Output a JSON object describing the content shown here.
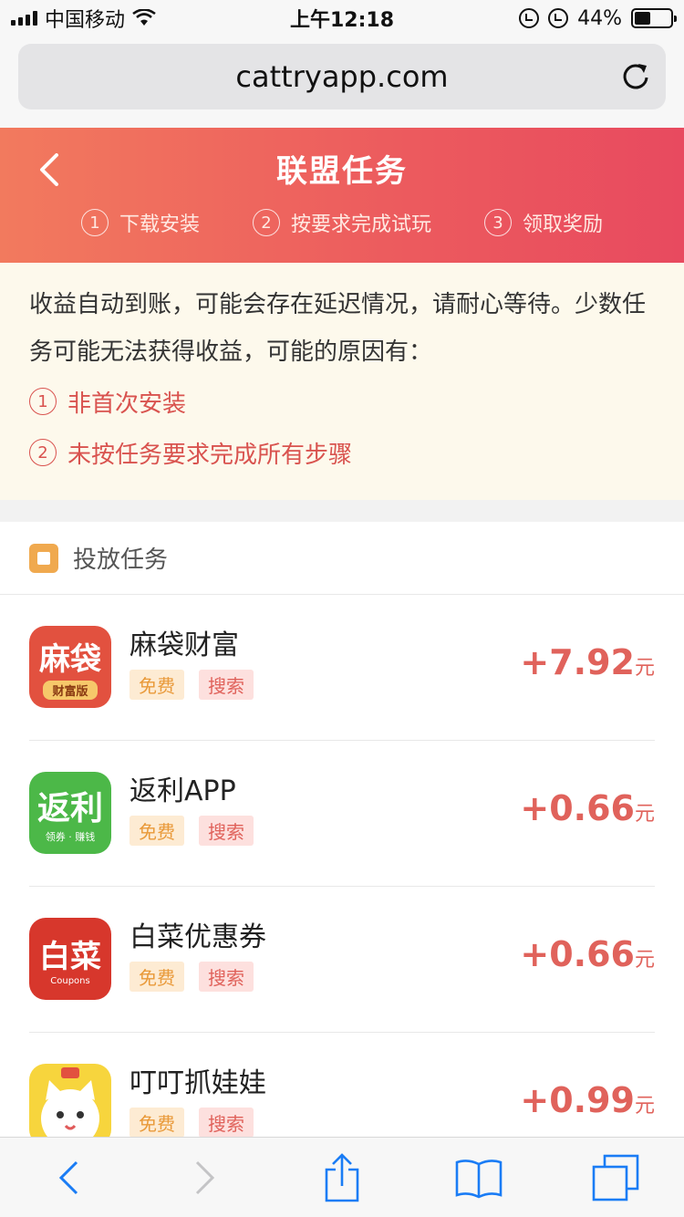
{
  "status_bar": {
    "carrier": "中国移动",
    "time": "上午12:18",
    "battery": "44%",
    "battery_level": 0.44,
    "icons": [
      "signal-icon",
      "wifi-icon",
      "rotation-lock-icon",
      "alarm-icon",
      "battery-icon"
    ]
  },
  "browser": {
    "url": "cattryapp.com"
  },
  "header": {
    "title": "联盟任务",
    "steps": [
      {
        "num": "1",
        "label": "下载安装"
      },
      {
        "num": "2",
        "label": "按要求完成试玩"
      },
      {
        "num": "3",
        "label": "领取奖励"
      }
    ]
  },
  "notice": {
    "text": "收益自动到账，可能会存在延迟情况，请耐心等待。少数任务可能无法获得收益，可能的原因有：",
    "reasons": [
      {
        "num": "1",
        "label": "非首次安装"
      },
      {
        "num": "2",
        "label": "未按任务要求完成所有步骤"
      }
    ]
  },
  "tasks": {
    "title": "投放任务",
    "items": [
      {
        "name": "麻袋财富",
        "icon_text": "麻袋",
        "icon_sub": "财富版",
        "tag_free": "免费",
        "tag_search": "搜索",
        "reward": "+7.92",
        "unit": "元",
        "color": "#e2513f"
      },
      {
        "name": "返利APP",
        "icon_text": "返利",
        "icon_sub": "领券 · 赚钱",
        "tag_free": "免费",
        "tag_search": "搜索",
        "reward": "+0.66",
        "unit": "元",
        "color": "#4cb848"
      },
      {
        "name": "白菜优惠券",
        "icon_text": "白菜",
        "icon_sub": "Coupons",
        "tag_free": "免费",
        "tag_search": "搜索",
        "reward": "+0.66",
        "unit": "元",
        "color": "#d7372c"
      },
      {
        "name": "叮叮抓娃娃",
        "icon_text": "",
        "icon_sub": "",
        "tag_free": "免费",
        "tag_search": "搜索",
        "reward": "+0.99",
        "unit": "元",
        "color": "#f7d53d"
      }
    ]
  },
  "colors": {
    "accent": "#e0625b",
    "header_start": "#f27a5e",
    "header_end": "#e84a5f",
    "ios_blue": "#1a7cf5"
  }
}
